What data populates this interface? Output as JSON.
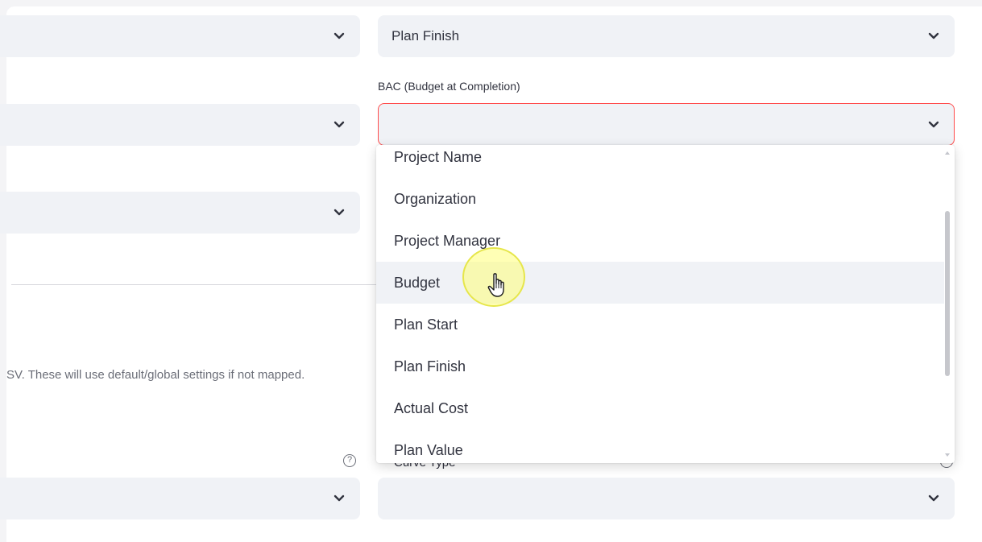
{
  "top_row": {
    "right_value": "Plan Finish"
  },
  "bac": {
    "label": "BAC (Budget at Completion)",
    "value": ""
  },
  "dropdown": {
    "options": [
      {
        "label": "Project Name"
      },
      {
        "label": "Organization"
      },
      {
        "label": "Project Manager"
      },
      {
        "label": "Budget",
        "hovered": true
      },
      {
        "label": "Plan Start"
      },
      {
        "label": "Plan Finish"
      },
      {
        "label": "Actual Cost"
      },
      {
        "label": "Plan Value"
      }
    ]
  },
  "optional_note": "SV. These will use default/global settings if not mapped.",
  "curve_type": {
    "label": "Curve Type"
  },
  "colors": {
    "select_bg": "#f0f2f6",
    "focus_border": "#ff4b4b",
    "text": "#31333f"
  },
  "icons": {
    "chevron": "chevron-down-icon",
    "help": "help-circle-icon",
    "cursor": "hand-pointer-icon"
  }
}
